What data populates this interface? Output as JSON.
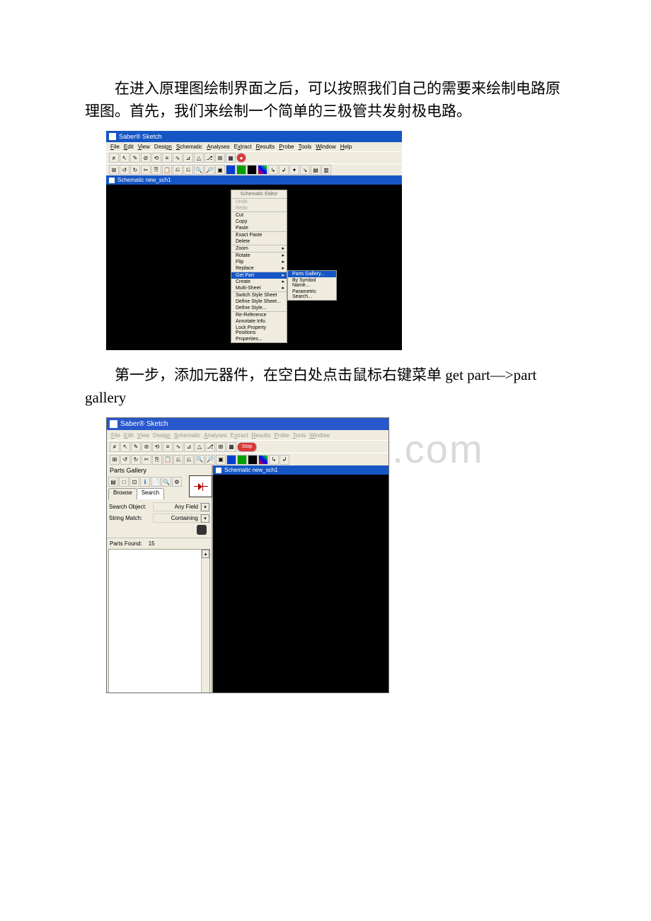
{
  "paragraph1": "在进入原理图绘制界面之后，可以按照我们自己的需要来绘制电路原理图。首先，我们来绘制一个简单的三极管共发射极电路。",
  "paragraph2_prefix": "第一步，添加元器件，在空白处点击鼠标右键菜单 ",
  "paragraph2_eng": "get part—>part gallery",
  "watermark": "面包杜.docx.com",
  "ss1": {
    "title": "Saber® Sketch",
    "menubar": [
      "File",
      "Edit",
      "View",
      "Design",
      "Schematic",
      "Analyses",
      "Extract",
      "Results",
      "Probe",
      "Tools",
      "Window",
      "Help"
    ],
    "canvas_title": "Schematic new_sch1",
    "ctx_header": "Schematic Editor",
    "ctx_items": [
      {
        "label": "Undo",
        "disabled": true
      },
      {
        "label": "Redo",
        "disabled": true
      },
      {
        "label": "Cut",
        "sep": true
      },
      {
        "label": "Copy"
      },
      {
        "label": "Paste"
      },
      {
        "label": "Exact Paste",
        "sep": true
      },
      {
        "label": "Delete"
      },
      {
        "label": "Zoom",
        "sep": true,
        "arrow": true
      },
      {
        "label": "Rotate",
        "sep": true,
        "arrow": true
      },
      {
        "label": "Flip",
        "arrow": true
      },
      {
        "label": "Replace",
        "arrow": true
      },
      {
        "label": "Get Part",
        "sep": true,
        "arrow": true,
        "sel": true
      },
      {
        "label": "Create",
        "arrow": true
      },
      {
        "label": "Multi-Sheet",
        "arrow": true
      },
      {
        "label": "Switch Style Sheet",
        "sep": true
      },
      {
        "label": "Define Style Sheet..."
      },
      {
        "label": "Define Style..."
      },
      {
        "label": "Re-Reference",
        "sep": true
      },
      {
        "label": "Annotate Info."
      },
      {
        "label": "Lock Property Positions"
      },
      {
        "label": "Properties..."
      }
    ],
    "submenu": [
      {
        "label": "Parts Gallery...",
        "sel": true
      },
      {
        "label": "By Symbol Name..."
      },
      {
        "label": "Parametric Search..."
      }
    ]
  },
  "ss2": {
    "title": "Saber® Sketch",
    "menubar": [
      "File",
      "Edit",
      "View",
      "Design",
      "Schematic",
      "Analyses",
      "Extract",
      "Results",
      "Probe",
      "Tools",
      "Window"
    ],
    "stop_label": "Stop",
    "pg_title": "Parts Gallery",
    "tabs": [
      "Browse",
      "Search"
    ],
    "search_object_label": "Search Object:",
    "search_object_value": "Any Field",
    "string_match_label": "String Match:",
    "string_match_value": "Containing",
    "parts_found_label": "Parts Found:",
    "parts_found_count": "15",
    "canvas_title": "Schematic new_sch1"
  }
}
